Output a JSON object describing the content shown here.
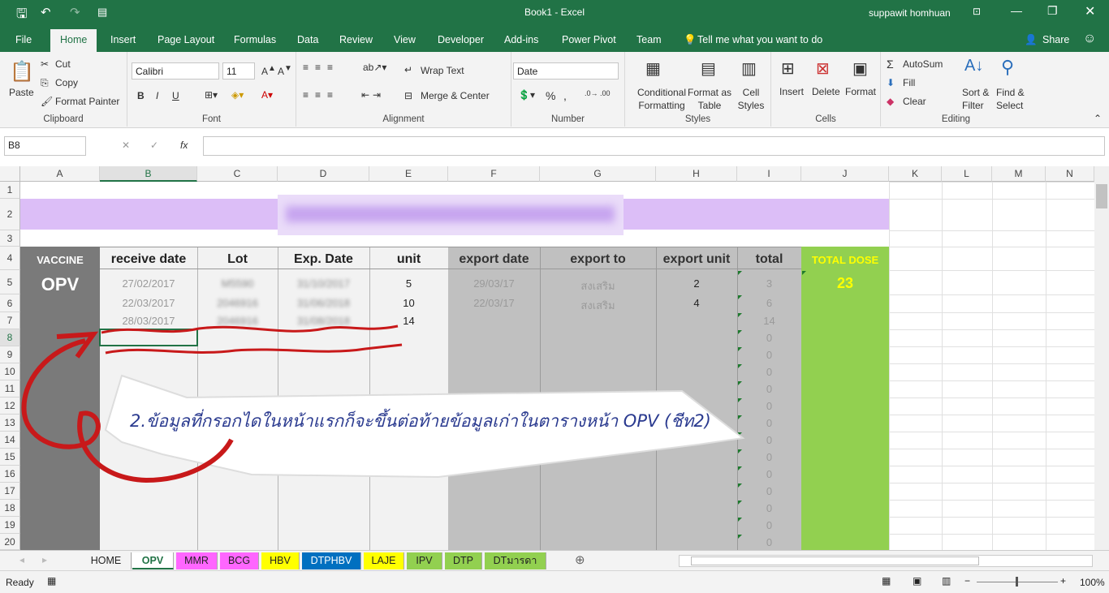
{
  "window": {
    "title": "Book1  -  Excel",
    "user": "suppawit homhuan"
  },
  "ribbon_tabs": [
    "File",
    "Home",
    "Insert",
    "Page Layout",
    "Formulas",
    "Data",
    "Review",
    "View",
    "Developer",
    "Add-ins",
    "Power Pivot",
    "Team"
  ],
  "tell_me": "Tell me what you want to do",
  "share": "Share",
  "clipboard": {
    "paste": "Paste",
    "cut": "Cut",
    "copy": "Copy",
    "format_painter": "Format Painter",
    "label": "Clipboard"
  },
  "font": {
    "name": "Calibri",
    "size": "11",
    "bold": "B",
    "italic": "I",
    "underline": "U",
    "label": "Font"
  },
  "alignment": {
    "wrap": "Wrap Text",
    "merge": "Merge & Center",
    "label": "Alignment"
  },
  "number": {
    "format": "Date",
    "percent": "%",
    "comma": ",",
    "label": "Number"
  },
  "styles": {
    "conditional": "Conditional Formatting",
    "format_table": "Format as Table",
    "cell_styles": "Cell Styles",
    "label": "Styles"
  },
  "cells": {
    "insert": "Insert",
    "delete": "Delete",
    "format": "Format",
    "label": "Cells"
  },
  "editing": {
    "autosum": "AutoSum",
    "fill": "Fill",
    "clear": "Clear",
    "sort": "Sort & Filter",
    "find": "Find & Select",
    "label": "Editing"
  },
  "formula_bar": {
    "name_box": "B8",
    "fx": "fx",
    "value": ""
  },
  "columns": [
    "A",
    "B",
    "C",
    "D",
    "E",
    "F",
    "G",
    "H",
    "I",
    "J",
    "K",
    "L",
    "M",
    "N"
  ],
  "rows": [
    "1",
    "2",
    "3",
    "4",
    "5",
    "6",
    "7",
    "8",
    "9",
    "10",
    "11",
    "12",
    "13",
    "14",
    "15",
    "16",
    "17",
    "18",
    "19",
    "20"
  ],
  "sheet": {
    "vaccine_label": "VACCINE",
    "vaccine_name": "OPV",
    "headers": [
      "receive date",
      "Lot",
      "Exp. Date",
      "unit",
      "export date",
      "export to",
      "export unit",
      "total"
    ],
    "total_dose_label": "TOTAL DOSE",
    "total_dose": "23",
    "data": [
      {
        "receive": "27/02/2017",
        "lot": "M5590",
        "exp": "31/10/2017",
        "unit": "5",
        "export_date": "29/03/17",
        "export_to": "สงเสริม",
        "export_unit": "2",
        "total": "3"
      },
      {
        "receive": "22/03/2017",
        "lot": "2046916",
        "exp": "31/06/2018",
        "unit": "10",
        "export_date": "22/03/17",
        "export_to": "สงเสริม",
        "export_unit": "4",
        "total": "6"
      },
      {
        "receive": "28/03/2017",
        "lot": "2046916",
        "exp": "31/08/2018",
        "unit": "14",
        "export_date": "",
        "export_to": "",
        "export_unit": "",
        "total": "14"
      }
    ],
    "zero_totals": [
      "0",
      "0",
      "0",
      "0",
      "0",
      "0",
      "0",
      "0",
      "0",
      "0",
      "0",
      "0",
      "0"
    ]
  },
  "annotation": "2.ข้อมูลที่กรอกไดในหน้าแรกก็จะขึ้นต่อท้ายข้อมูลเก่าในตารางหน้า OPV (ชีท2)",
  "sheet_tabs": [
    {
      "name": "HOME",
      "color": "#f3f3f3"
    },
    {
      "name": "OPV",
      "color": "#ffffff"
    },
    {
      "name": "MMR",
      "color": "#ff66ff"
    },
    {
      "name": "BCG",
      "color": "#ff66ff"
    },
    {
      "name": "HBV",
      "color": "#ffff00"
    },
    {
      "name": "DTPHBV",
      "color": "#0070c0"
    },
    {
      "name": "LAJE",
      "color": "#ffff00"
    },
    {
      "name": "IPV",
      "color": "#92d050"
    },
    {
      "name": "DTP",
      "color": "#92d050"
    },
    {
      "name": "DTมารดา",
      "color": "#92d050"
    }
  ],
  "status": {
    "ready": "Ready",
    "zoom": "100%"
  }
}
